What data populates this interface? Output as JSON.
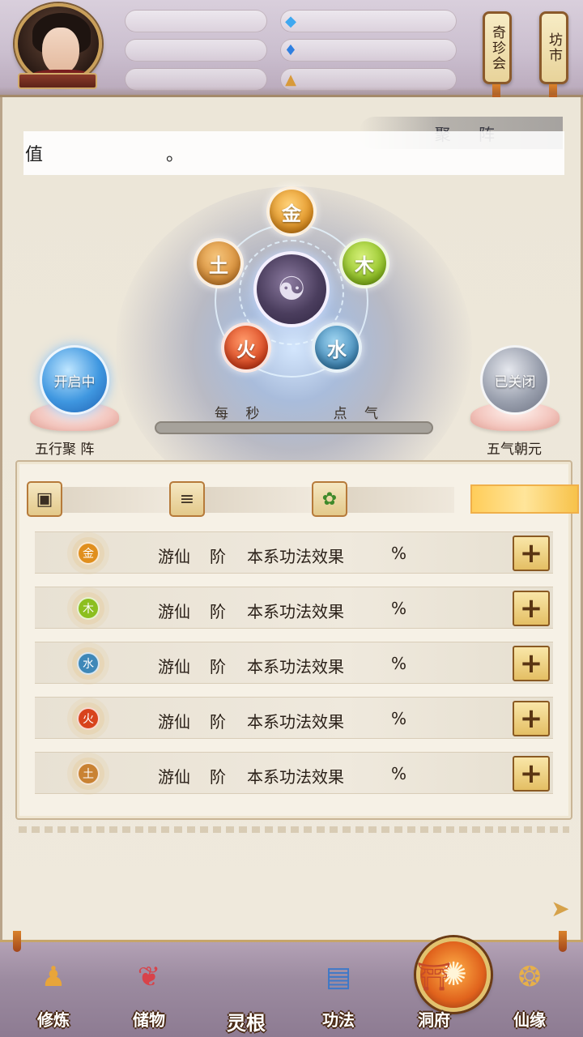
{
  "side_buttons": {
    "treasure_fair": "奇珍会",
    "market": "坊市"
  },
  "main": {
    "title": "聚 阵",
    "notice_prefix": "值",
    "notice_suffix": "。",
    "per_second_left": "每 秒",
    "per_second_right": "点 气",
    "progress_fraction": 0
  },
  "formation": {
    "center_icon": "yin-yang-icon",
    "elements": [
      {
        "key": "gold",
        "label": "金"
      },
      {
        "key": "wood",
        "label": "木"
      },
      {
        "key": "water",
        "label": "水"
      },
      {
        "key": "fire",
        "label": "火"
      },
      {
        "key": "earth",
        "label": "土"
      }
    ]
  },
  "toggles": {
    "left_status": "开启中",
    "left_label": "五行聚 阵",
    "right_status": "已关闭",
    "right_label": "五气朝元"
  },
  "materials": {
    "icons": [
      "ore-icon",
      "wood-log-icon",
      "herb-icon"
    ]
  },
  "attributes": [
    {
      "element": "金",
      "rank": "游仙",
      "tier": "阶",
      "effect": "本系功法效果",
      "unit": "%",
      "color": "#e08f1e"
    },
    {
      "element": "木",
      "rank": "游仙",
      "tier": "阶",
      "effect": "本系功法效果",
      "unit": "%",
      "color": "#8cbf1f"
    },
    {
      "element": "水",
      "rank": "游仙",
      "tier": "阶",
      "effect": "本系功法效果",
      "unit": "%",
      "color": "#3f88b8"
    },
    {
      "element": "火",
      "rank": "游仙",
      "tier": "阶",
      "effect": "本系功法效果",
      "unit": "%",
      "color": "#d8431d"
    },
    {
      "element": "土",
      "rank": "游仙",
      "tier": "阶",
      "effect": "本系功法效果",
      "unit": "%",
      "color": "#c98233"
    }
  ],
  "plus_label": "+",
  "bottom_nav": [
    {
      "label": "修炼",
      "icon": "cultivator-icon"
    },
    {
      "label": "储物",
      "icon": "pouch-icon"
    },
    {
      "label": "灵根",
      "icon": "spirit-root-icon"
    },
    {
      "label": "功法",
      "icon": "scripture-book-icon"
    },
    {
      "label": "洞府",
      "icon": "cave-dwelling-icon"
    },
    {
      "label": "仙缘",
      "icon": "gourd-icon"
    }
  ]
}
